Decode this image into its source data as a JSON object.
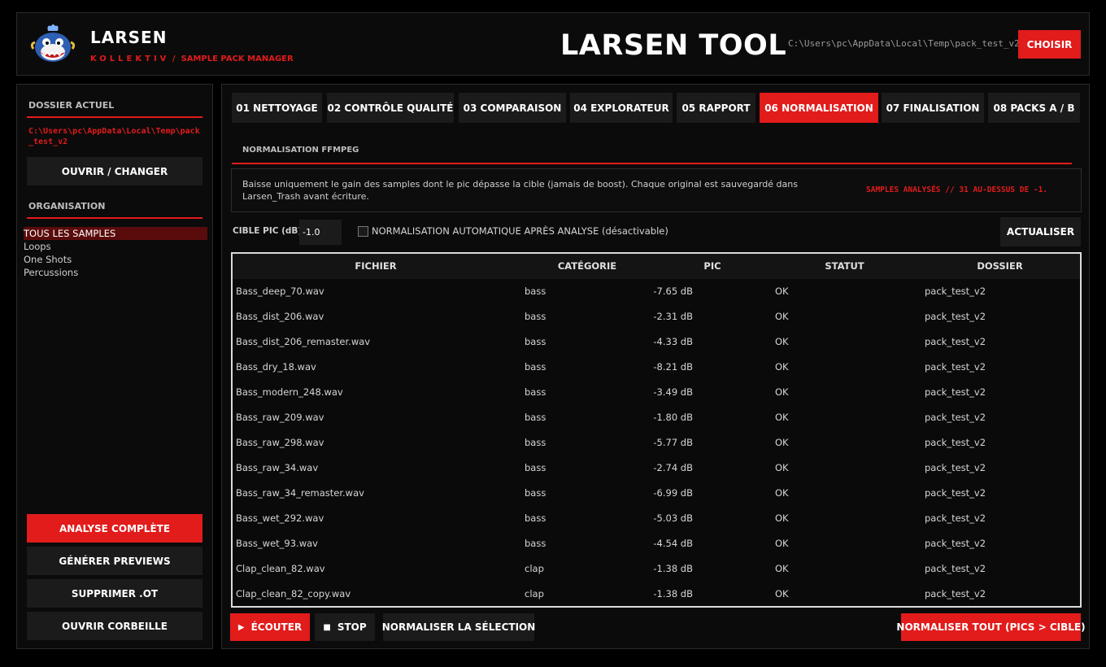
{
  "header": {
    "brand_name": "LARSEN",
    "brand_sub_k": "KOLLEKTIV",
    "brand_sub_sep": "/",
    "brand_sub_rest": "SAMPLE PACK MANAGER",
    "app_title": "LARSEN TOOL",
    "path": "C:\\Users\\pc\\AppData\\Local\\Temp\\pack_test_v2",
    "choose_label": "CHOISIR",
    "logo_icon": "whale-mascot-logo"
  },
  "sidebar": {
    "current_folder_heading": "DOSSIER ACTUEL",
    "current_path": "C:\\Users\\pc\\AppData\\Local\\Temp\\pack_test_v2",
    "open_change_label": "OUVRIR / CHANGER",
    "organisation_heading": "ORGANISATION",
    "items": [
      {
        "label": "TOUS LES SAMPLES",
        "active": true
      },
      {
        "label": "Loops",
        "active": false
      },
      {
        "label": "One Shots",
        "active": false
      },
      {
        "label": "Percussions",
        "active": false
      }
    ],
    "full_analysis_label": "ANALYSE COMPLÈTE",
    "generate_previews_label": "GÉNÉRER PREVIEWS",
    "delete_ot_label": "SUPPRIMER .OT",
    "open_trash_label": "OUVRIR CORBEILLE"
  },
  "tabs": [
    {
      "label": "01 NETTOYAGE"
    },
    {
      "label": "02 CONTRÔLE QUALITÉ"
    },
    {
      "label": "03 COMPARAISON"
    },
    {
      "label": "04 EXPLORATEUR"
    },
    {
      "label": "05 RAPPORT"
    },
    {
      "label": "06 NORMALISATION",
      "active": true
    },
    {
      "label": "07 FINALISATION"
    },
    {
      "label": "08 PACKS A / B"
    }
  ],
  "normalisation": {
    "section_title": "NORMALISATION FFMPEG",
    "info_text": "Baisse uniquement le gain des samples dont le pic dépasse la cible (jamais de boost). Chaque original est sauvegardé dans Larsen_Trash avant écriture.",
    "status_text": "SAMPLES ANALYSÉS   //   31 AU-DESSUS DE -1.",
    "cible_label": "CIBLE PIC (dB)",
    "cible_value": "-1.0",
    "auto_label": "NORMALISATION AUTOMATIQUE APRÈS ANALYSE (désactivable)",
    "auto_checked": false,
    "refresh_label": "ACTUALISER"
  },
  "table": {
    "headers": [
      "FICHIER",
      "CATÉGORIE",
      "PIC",
      "STATUT",
      "DOSSIER"
    ],
    "rows": [
      [
        "Bass_deep_70.wav",
        "bass",
        "-7.65 dB",
        "OK",
        "pack_test_v2"
      ],
      [
        "Bass_dist_206.wav",
        "bass",
        "-2.31 dB",
        "OK",
        "pack_test_v2"
      ],
      [
        "Bass_dist_206_remaster.wav",
        "bass",
        "-4.33 dB",
        "OK",
        "pack_test_v2"
      ],
      [
        "Bass_dry_18.wav",
        "bass",
        "-8.21 dB",
        "OK",
        "pack_test_v2"
      ],
      [
        "Bass_modern_248.wav",
        "bass",
        "-3.49 dB",
        "OK",
        "pack_test_v2"
      ],
      [
        "Bass_raw_209.wav",
        "bass",
        "-1.80 dB",
        "OK",
        "pack_test_v2"
      ],
      [
        "Bass_raw_298.wav",
        "bass",
        "-5.77 dB",
        "OK",
        "pack_test_v2"
      ],
      [
        "Bass_raw_34.wav",
        "bass",
        "-2.74 dB",
        "OK",
        "pack_test_v2"
      ],
      [
        "Bass_raw_34_remaster.wav",
        "bass",
        "-6.99 dB",
        "OK",
        "pack_test_v2"
      ],
      [
        "Bass_wet_292.wav",
        "bass",
        "-5.03 dB",
        "OK",
        "pack_test_v2"
      ],
      [
        "Bass_wet_93.wav",
        "bass",
        "-4.54 dB",
        "OK",
        "pack_test_v2"
      ],
      [
        "Clap_clean_82.wav",
        "clap",
        "-1.38 dB",
        "OK",
        "pack_test_v2"
      ],
      [
        "Clap_clean_82_copy.wav",
        "clap",
        "-1.38 dB",
        "OK",
        "pack_test_v2"
      ]
    ]
  },
  "actions": {
    "listen_label": "ÉCOUTER",
    "listen_icon": "play-icon",
    "stop_label": "STOP",
    "stop_icon": "stop-icon",
    "normalize_selection_label": "NORMALISER LA SÉLECTION",
    "normalize_all_label": "NORMALISER TOUT (PICS > CIBLE)"
  },
  "colors": {
    "accent": "#e21b1b",
    "background": "#000000",
    "panel": "#0b0b0b",
    "button": "#1b1b1b",
    "active_item": "#5a0b0b"
  }
}
